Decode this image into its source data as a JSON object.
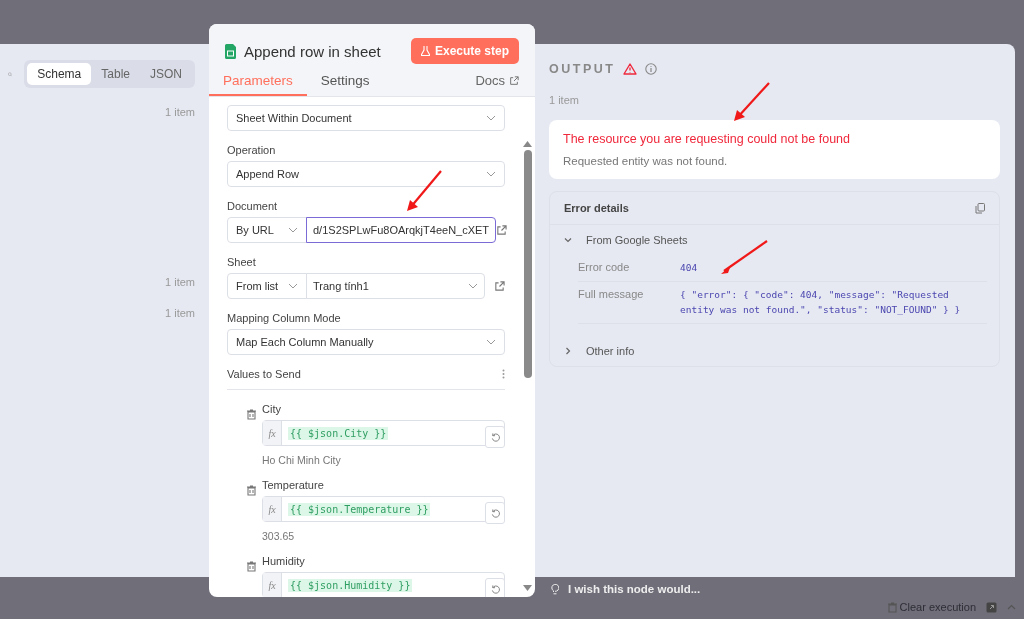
{
  "input_panel": {
    "tabs": [
      {
        "label": "Schema",
        "selected": true
      },
      {
        "label": "Table",
        "selected": false
      },
      {
        "label": "JSON",
        "selected": false
      }
    ],
    "counts": [
      "1 item",
      "1 item",
      "1 item"
    ]
  },
  "node": {
    "title": "Append row in sheet",
    "execute_button": "Execute step",
    "tabs": [
      {
        "label": "Parameters",
        "selected": true
      },
      {
        "label": "Settings",
        "selected": false
      }
    ],
    "docs_link": "Docs",
    "params": [
      {
        "kind": "select",
        "value": "Sheet Within Document"
      },
      {
        "kind": "select",
        "label": "Operation",
        "value": "Append Row"
      },
      {
        "kind": "locator",
        "label": "Document",
        "mode": "By URL",
        "value": "d/1S2SPLwFu8OArqkjT4eeN_cXET",
        "dropdown": false,
        "focused": true
      },
      {
        "kind": "locator",
        "label": "Sheet",
        "mode": "From list",
        "value": "Trang tính1",
        "dropdown": true,
        "focused": false
      },
      {
        "kind": "select",
        "label": "Mapping Column Mode",
        "value": "Map Each Column Manually"
      }
    ],
    "values_to_send": {
      "title": "Values to Send",
      "fields": [
        {
          "name": "City",
          "fx": "fx",
          "expression": "{{ $json.City }}",
          "result": "Ho Chi Minh City"
        },
        {
          "name": "Temperature",
          "fx": "fx",
          "expression": "{{ $json.Temperature }}",
          "result": "303.65"
        },
        {
          "name": "Humidity",
          "fx": "fx",
          "expression": "{{ $json.Humidity }}"
        }
      ]
    }
  },
  "output": {
    "title": "OUTPUT",
    "count": "1 item",
    "error": {
      "title": "The resource you are requesting could not be found",
      "description": "Requested entity was not found."
    },
    "details": {
      "title": "Error details",
      "sections": [
        {
          "label": "From Google Sheets",
          "expanded": true,
          "rows": [
            {
              "label": "Error code",
              "value": "404"
            },
            {
              "label": "Full message",
              "value": "{ \"error\": { \"code\": 404, \"message\": \"Requested entity was not found.\", \"status\": \"NOT_FOUND\" } }"
            }
          ]
        },
        {
          "label": "Other info",
          "expanded": false
        }
      ]
    }
  },
  "footer": {
    "feedback": "I wish this node would...",
    "clear": "Clear execution"
  }
}
